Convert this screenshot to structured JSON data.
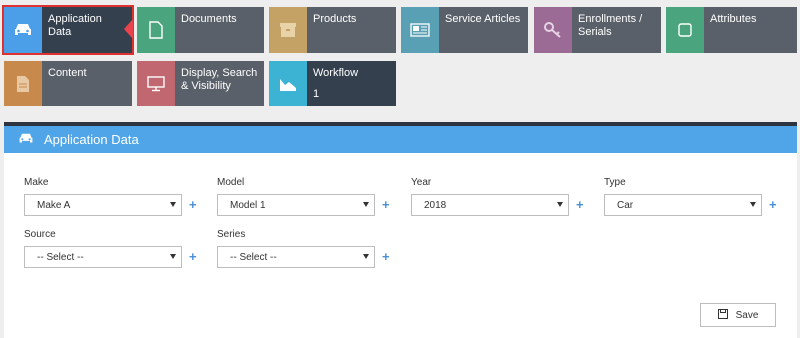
{
  "tiles": [
    {
      "label": "Application Data",
      "icon": "car-icon",
      "color": "#4a9fe8"
    },
    {
      "label": "Documents",
      "icon": "document-icon",
      "color": "#4aa57e"
    },
    {
      "label": "Products",
      "icon": "box-icon",
      "color": "#c4a266"
    },
    {
      "label": "Service Articles",
      "icon": "newspaper-icon",
      "color": "#5aa0b5"
    },
    {
      "label": "Enrollments / Serials",
      "icon": "key-icon",
      "color": "#9b6b96"
    },
    {
      "label": "Attributes",
      "icon": "checkbox-icon",
      "color": "#4aa57e"
    },
    {
      "label": "Content",
      "icon": "file-icon",
      "color": "#c88a4c"
    },
    {
      "label": "Display, Search & Visibility",
      "icon": "monitor-icon",
      "color": "#c16770"
    },
    {
      "label": "Workflow",
      "icon": "chart-icon",
      "color": "#3db3d4",
      "count": "1"
    }
  ],
  "panel": {
    "title": "Application Data"
  },
  "fields": {
    "make": {
      "label": "Make",
      "value": "Make A"
    },
    "model": {
      "label": "Model",
      "value": "Model 1"
    },
    "year": {
      "label": "Year",
      "value": "2018"
    },
    "type": {
      "label": "Type",
      "value": "Car"
    },
    "source": {
      "label": "Source",
      "value": "-- Select --"
    },
    "series": {
      "label": "Series",
      "value": "-- Select --"
    }
  },
  "plus_symbol": "+",
  "save_label": "Save"
}
